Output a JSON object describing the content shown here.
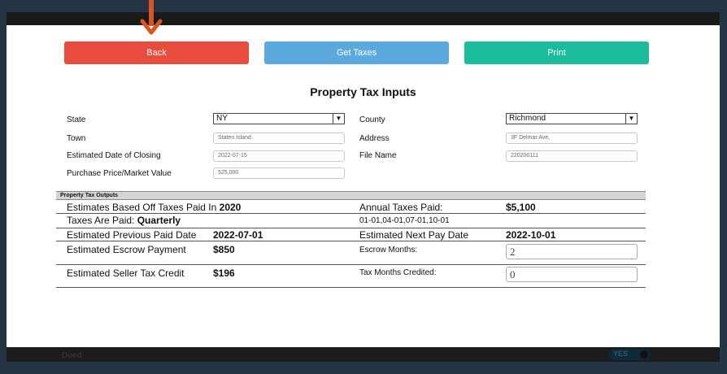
{
  "buttons": {
    "back": "Back",
    "get_taxes": "Get Taxes",
    "print": "Print"
  },
  "title": "Property Tax Inputs",
  "inputs": {
    "state_label": "State",
    "state_value": "NY",
    "county_label": "County",
    "county_value": "Richmond",
    "town_label": "Town",
    "town_value": "Staten Island",
    "address_label": "Address",
    "address_value": "3F Delmar Ave,",
    "closing_label": "Estimated Date of Closing",
    "closing_value": "2022-07-15",
    "filename_label": "File Name",
    "filename_value": "220200111",
    "price_label": "Purchase Price/Market Value",
    "price_value": "525,000"
  },
  "outputs": {
    "header": "Property Tax Outputs",
    "estimates_label": "Estimates Based Off Taxes Paid In ",
    "estimates_year": "2020",
    "annual_label": "Annual Taxes Paid:",
    "annual_value": "$5,100",
    "paid_label": "Taxes Are Paid: ",
    "paid_value": "Quarterly",
    "pay_dates": "01-01,04-01,07-01,10-01",
    "prev_label": "Estimated Previous Paid Date",
    "prev_value": "2022-07-01",
    "next_label": "Estimated Next Pay Date",
    "next_value": "2022-10-01",
    "escrow_label": "Estimated Escrow Payment",
    "escrow_value": "$850",
    "escrow_months_label": "Escrow Months:",
    "escrow_months_value": "2",
    "credit_label": "Estimated Seller Tax Credit",
    "credit_value": "$196",
    "months_credited_label": "Tax Months Credited:",
    "months_credited_value": "0"
  },
  "bottom": {
    "label": "Deed",
    "toggle": "YES"
  },
  "colors": {
    "back": "#e84c3d",
    "get_taxes": "#5aaae0",
    "print": "#1abc9c",
    "arrow": "#d9541e"
  }
}
